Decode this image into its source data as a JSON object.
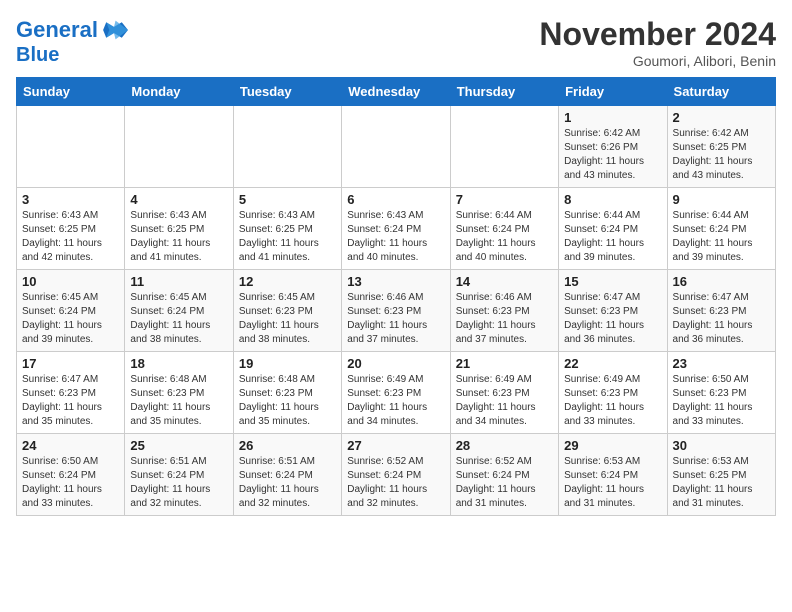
{
  "header": {
    "logo_line1": "General",
    "logo_line2": "Blue",
    "month_title": "November 2024",
    "location": "Goumori, Alibori, Benin"
  },
  "weekdays": [
    "Sunday",
    "Monday",
    "Tuesday",
    "Wednesday",
    "Thursday",
    "Friday",
    "Saturday"
  ],
  "weeks": [
    [
      {
        "day": "",
        "info": ""
      },
      {
        "day": "",
        "info": ""
      },
      {
        "day": "",
        "info": ""
      },
      {
        "day": "",
        "info": ""
      },
      {
        "day": "",
        "info": ""
      },
      {
        "day": "1",
        "info": "Sunrise: 6:42 AM\nSunset: 6:26 PM\nDaylight: 11 hours and 43 minutes."
      },
      {
        "day": "2",
        "info": "Sunrise: 6:42 AM\nSunset: 6:25 PM\nDaylight: 11 hours and 43 minutes."
      }
    ],
    [
      {
        "day": "3",
        "info": "Sunrise: 6:43 AM\nSunset: 6:25 PM\nDaylight: 11 hours and 42 minutes."
      },
      {
        "day": "4",
        "info": "Sunrise: 6:43 AM\nSunset: 6:25 PM\nDaylight: 11 hours and 41 minutes."
      },
      {
        "day": "5",
        "info": "Sunrise: 6:43 AM\nSunset: 6:25 PM\nDaylight: 11 hours and 41 minutes."
      },
      {
        "day": "6",
        "info": "Sunrise: 6:43 AM\nSunset: 6:24 PM\nDaylight: 11 hours and 40 minutes."
      },
      {
        "day": "7",
        "info": "Sunrise: 6:44 AM\nSunset: 6:24 PM\nDaylight: 11 hours and 40 minutes."
      },
      {
        "day": "8",
        "info": "Sunrise: 6:44 AM\nSunset: 6:24 PM\nDaylight: 11 hours and 39 minutes."
      },
      {
        "day": "9",
        "info": "Sunrise: 6:44 AM\nSunset: 6:24 PM\nDaylight: 11 hours and 39 minutes."
      }
    ],
    [
      {
        "day": "10",
        "info": "Sunrise: 6:45 AM\nSunset: 6:24 PM\nDaylight: 11 hours and 39 minutes."
      },
      {
        "day": "11",
        "info": "Sunrise: 6:45 AM\nSunset: 6:24 PM\nDaylight: 11 hours and 38 minutes."
      },
      {
        "day": "12",
        "info": "Sunrise: 6:45 AM\nSunset: 6:23 PM\nDaylight: 11 hours and 38 minutes."
      },
      {
        "day": "13",
        "info": "Sunrise: 6:46 AM\nSunset: 6:23 PM\nDaylight: 11 hours and 37 minutes."
      },
      {
        "day": "14",
        "info": "Sunrise: 6:46 AM\nSunset: 6:23 PM\nDaylight: 11 hours and 37 minutes."
      },
      {
        "day": "15",
        "info": "Sunrise: 6:47 AM\nSunset: 6:23 PM\nDaylight: 11 hours and 36 minutes."
      },
      {
        "day": "16",
        "info": "Sunrise: 6:47 AM\nSunset: 6:23 PM\nDaylight: 11 hours and 36 minutes."
      }
    ],
    [
      {
        "day": "17",
        "info": "Sunrise: 6:47 AM\nSunset: 6:23 PM\nDaylight: 11 hours and 35 minutes."
      },
      {
        "day": "18",
        "info": "Sunrise: 6:48 AM\nSunset: 6:23 PM\nDaylight: 11 hours and 35 minutes."
      },
      {
        "day": "19",
        "info": "Sunrise: 6:48 AM\nSunset: 6:23 PM\nDaylight: 11 hours and 35 minutes."
      },
      {
        "day": "20",
        "info": "Sunrise: 6:49 AM\nSunset: 6:23 PM\nDaylight: 11 hours and 34 minutes."
      },
      {
        "day": "21",
        "info": "Sunrise: 6:49 AM\nSunset: 6:23 PM\nDaylight: 11 hours and 34 minutes."
      },
      {
        "day": "22",
        "info": "Sunrise: 6:49 AM\nSunset: 6:23 PM\nDaylight: 11 hours and 33 minutes."
      },
      {
        "day": "23",
        "info": "Sunrise: 6:50 AM\nSunset: 6:23 PM\nDaylight: 11 hours and 33 minutes."
      }
    ],
    [
      {
        "day": "24",
        "info": "Sunrise: 6:50 AM\nSunset: 6:24 PM\nDaylight: 11 hours and 33 minutes."
      },
      {
        "day": "25",
        "info": "Sunrise: 6:51 AM\nSunset: 6:24 PM\nDaylight: 11 hours and 32 minutes."
      },
      {
        "day": "26",
        "info": "Sunrise: 6:51 AM\nSunset: 6:24 PM\nDaylight: 11 hours and 32 minutes."
      },
      {
        "day": "27",
        "info": "Sunrise: 6:52 AM\nSunset: 6:24 PM\nDaylight: 11 hours and 32 minutes."
      },
      {
        "day": "28",
        "info": "Sunrise: 6:52 AM\nSunset: 6:24 PM\nDaylight: 11 hours and 31 minutes."
      },
      {
        "day": "29",
        "info": "Sunrise: 6:53 AM\nSunset: 6:24 PM\nDaylight: 11 hours and 31 minutes."
      },
      {
        "day": "30",
        "info": "Sunrise: 6:53 AM\nSunset: 6:25 PM\nDaylight: 11 hours and 31 minutes."
      }
    ]
  ]
}
